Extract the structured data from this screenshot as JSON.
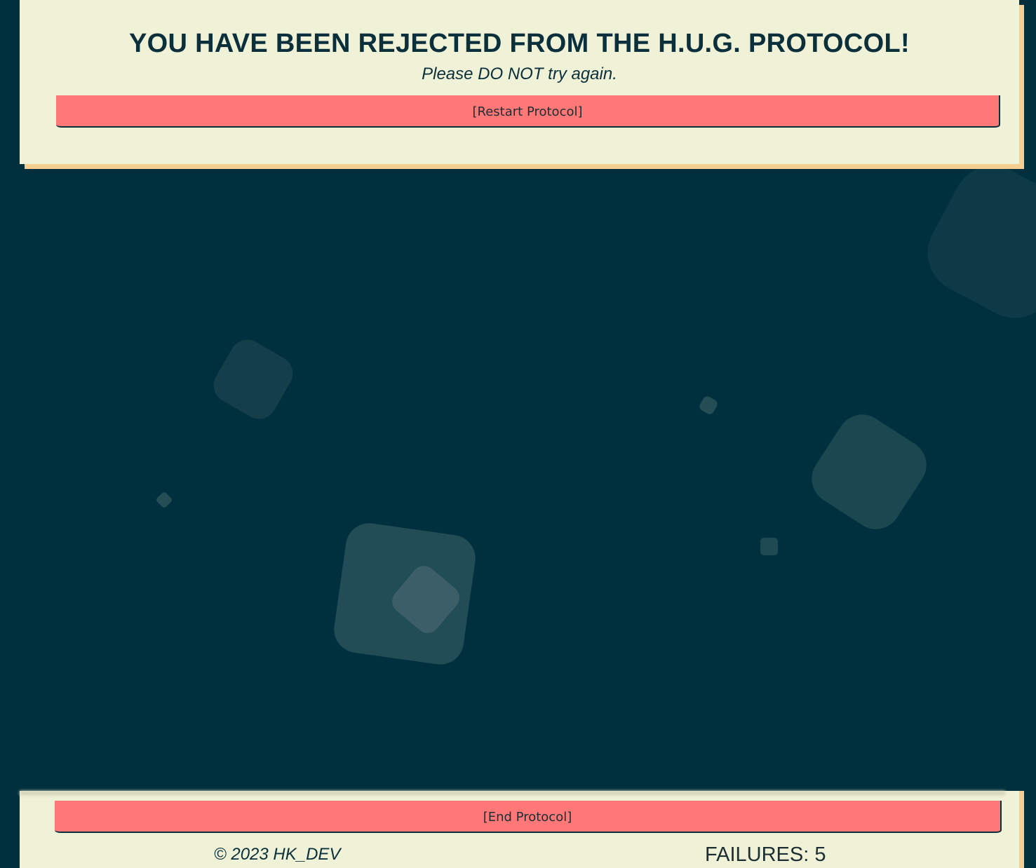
{
  "header": {
    "title": "YOU HAVE BEEN REJECTED FROM THE H.U.G. PROTOCOL!",
    "subtitle": "Please DO NOT try again.",
    "restart_label": "[Restart Protocol]"
  },
  "footer": {
    "end_label": "[End Protocol]",
    "copyright": "© 2023 HK_DEV",
    "failures_label": "FAILURES: 5"
  },
  "colors": {
    "background": "#00303d",
    "card": "#f0f2d8",
    "card_shadow": "#f5cf92",
    "button": "#ff7878",
    "text_dark": "#0b2f3b"
  }
}
